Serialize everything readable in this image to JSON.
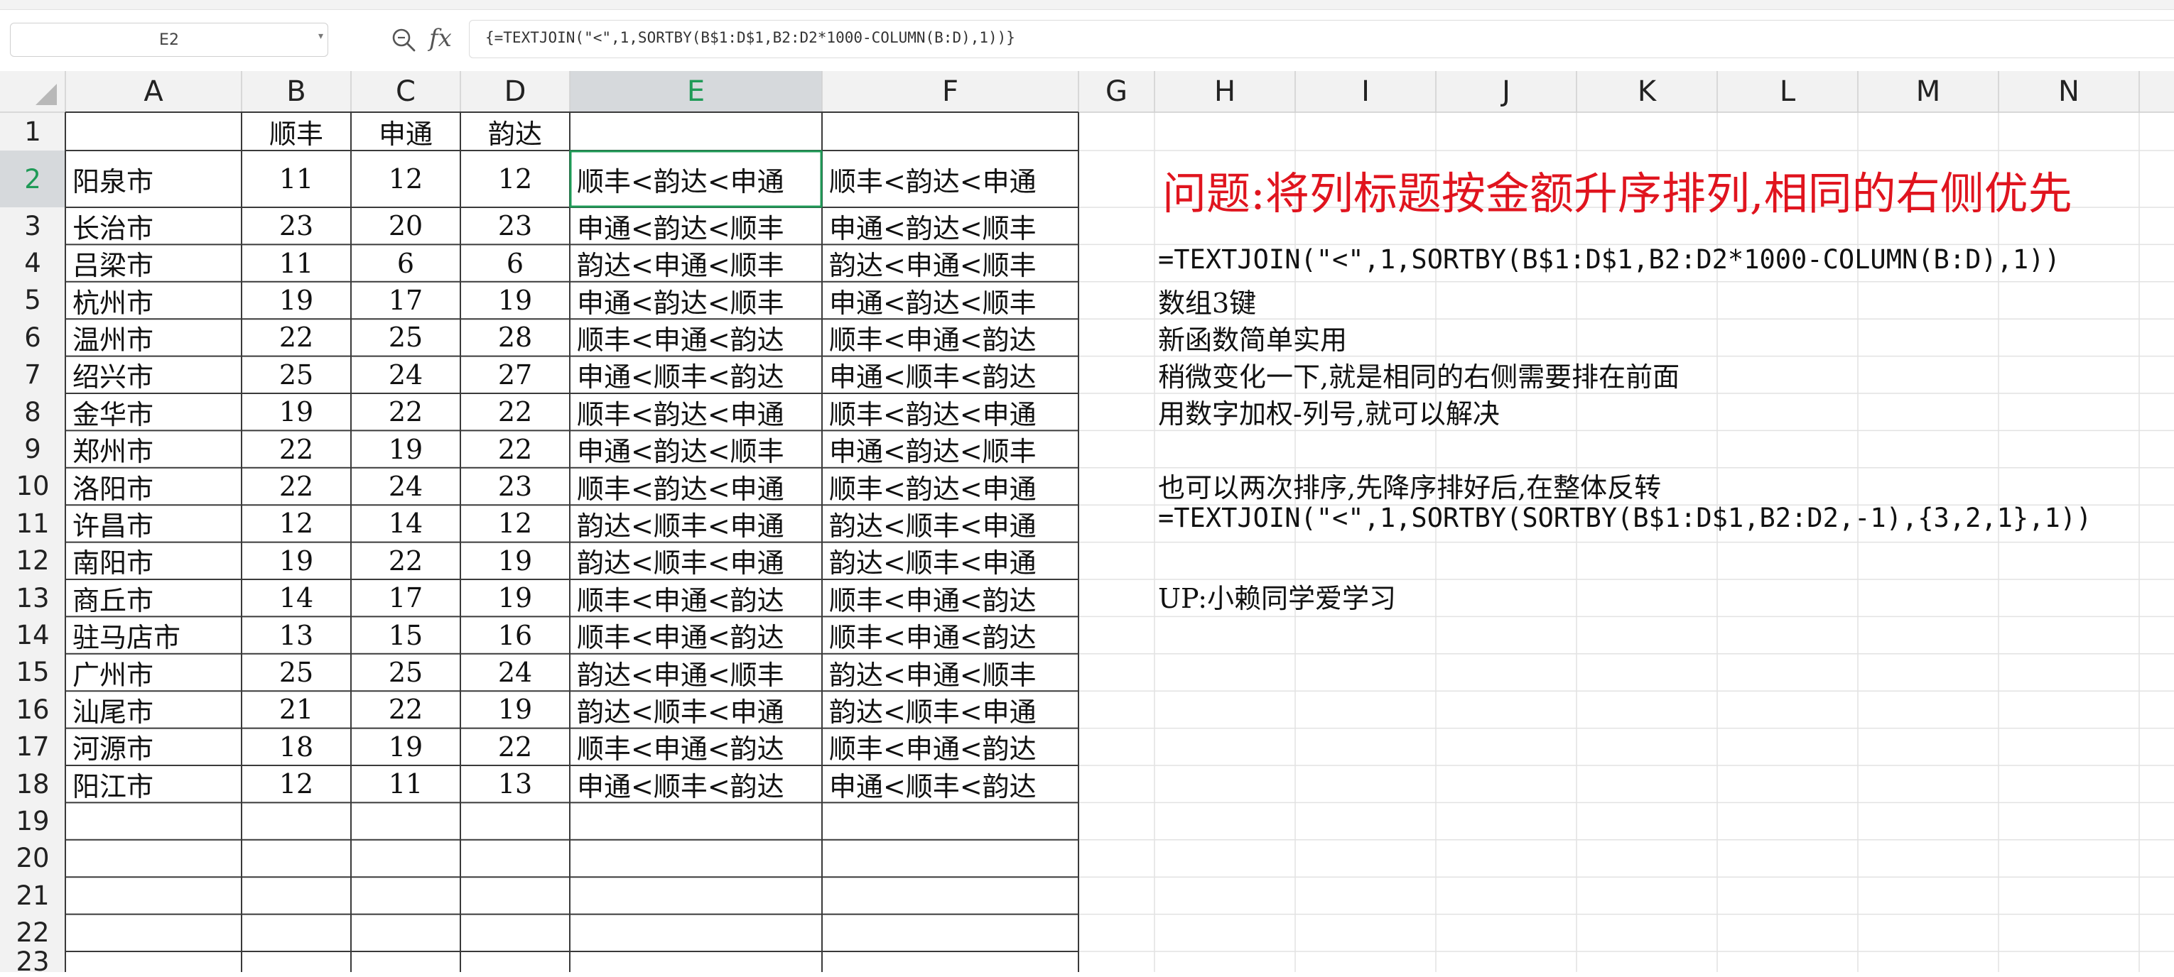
{
  "namebox": {
    "value": "E2"
  },
  "formula_bar": {
    "formula": "{=TEXTJOIN(\"<\",1,SORTBY(B$1:D$1,B2:D2*1000-COLUMN(B:D),1))}"
  },
  "columns": [
    "A",
    "B",
    "C",
    "D",
    "E",
    "F",
    "G",
    "H",
    "I",
    "J",
    "K",
    "L",
    "M",
    "N"
  ],
  "rows": [
    "1",
    "2",
    "3",
    "4",
    "5",
    "6",
    "7",
    "8",
    "9",
    "10",
    "11",
    "12",
    "13",
    "14",
    "15",
    "16",
    "17",
    "18",
    "19",
    "20",
    "21",
    "22",
    "23"
  ],
  "active_cell": {
    "column": "E",
    "row": "2"
  },
  "header_row": [
    "",
    "顺丰",
    "申通",
    "韵达",
    "",
    ""
  ],
  "table_rows": [
    [
      "阳泉市",
      "11",
      "12",
      "12",
      "顺丰<韵达<申通",
      "顺丰<韵达<申通"
    ],
    [
      "长治市",
      "23",
      "20",
      "23",
      "申通<韵达<顺丰",
      "申通<韵达<顺丰"
    ],
    [
      "吕梁市",
      "11",
      "6",
      "6",
      "韵达<申通<顺丰",
      "韵达<申通<顺丰"
    ],
    [
      "杭州市",
      "19",
      "17",
      "19",
      "申通<韵达<顺丰",
      "申通<韵达<顺丰"
    ],
    [
      "温州市",
      "22",
      "25",
      "28",
      "顺丰<申通<韵达",
      "顺丰<申通<韵达"
    ],
    [
      "绍兴市",
      "25",
      "24",
      "27",
      "申通<顺丰<韵达",
      "申通<顺丰<韵达"
    ],
    [
      "金华市",
      "19",
      "22",
      "22",
      "顺丰<韵达<申通",
      "顺丰<韵达<申通"
    ],
    [
      "郑州市",
      "22",
      "19",
      "22",
      "申通<韵达<顺丰",
      "申通<韵达<顺丰"
    ],
    [
      "洛阳市",
      "22",
      "24",
      "23",
      "顺丰<韵达<申通",
      "顺丰<韵达<申通"
    ],
    [
      "许昌市",
      "12",
      "14",
      "12",
      "韵达<顺丰<申通",
      "韵达<顺丰<申通"
    ],
    [
      "南阳市",
      "19",
      "22",
      "19",
      "韵达<顺丰<申通",
      "韵达<顺丰<申通"
    ],
    [
      "商丘市",
      "14",
      "17",
      "19",
      "顺丰<申通<韵达",
      "顺丰<申通<韵达"
    ],
    [
      "驻马店市",
      "13",
      "15",
      "16",
      "顺丰<申通<韵达",
      "顺丰<申通<韵达"
    ],
    [
      "广州市",
      "25",
      "25",
      "24",
      "韵达<申通<顺丰",
      "韵达<申通<顺丰"
    ],
    [
      "汕尾市",
      "21",
      "22",
      "19",
      "韵达<顺丰<申通",
      "韵达<顺丰<申通"
    ],
    [
      "河源市",
      "18",
      "19",
      "22",
      "顺丰<申通<韵达",
      "顺丰<申通<韵达"
    ],
    [
      "阳江市",
      "12",
      "11",
      "13",
      "申通<顺丰<韵达",
      "申通<顺丰<韵达"
    ]
  ],
  "notes": {
    "title": "问题:将列标题按金额升序排列,相同的右侧优先",
    "formula1": "=TEXTJOIN(\"<\",1,SORTBY(B$1:D$1,B2:D2*1000-COLUMN(B:D),1))",
    "array_keys": "数组3键",
    "new_function": "新函数简单实用",
    "variation": "稍微变化一下,就是相同的右侧需要排在前面",
    "weighting": "用数字加权-列号,就可以解决",
    "two_sorts": "也可以两次排序,先降序排好后,在整体反转",
    "formula2": "=TEXTJOIN(\"<\",1,SORTBY(SORTBY(B$1:D$1,B2:D2,-1),{3,2,1},1))",
    "author": "UP:小赖同学爱学习"
  },
  "colors": {
    "accent": "#1f9a57",
    "title_red": "#e0141e",
    "header_fill": "#f2f2f2",
    "active_header_fill": "#d6d9dc",
    "gridline": "#e2e2e2",
    "table_border": "#3a3a3a"
  },
  "icons": {
    "zoom": "zoom-search-icon",
    "formula": "fx-icon"
  }
}
